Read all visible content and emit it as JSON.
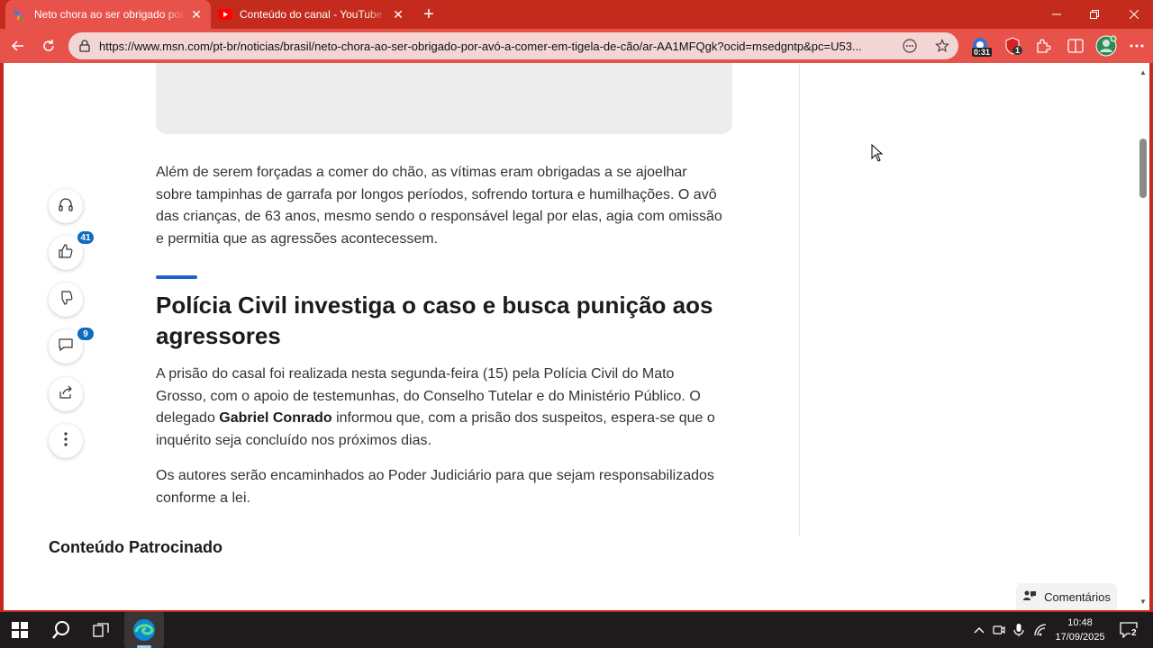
{
  "browser": {
    "tabs": [
      {
        "title": "Neto chora ao ser obrigado por avó",
        "active": true,
        "favicon": "msn-butterfly-icon"
      },
      {
        "title": "Conteúdo do canal - YouTube Studio",
        "active": false,
        "favicon": "youtube-icon"
      }
    ],
    "new_tab": "+",
    "url": "https://www.msn.com/pt-br/noticias/brasil/neto-chora-ao-ser-obrigado-por-avó-a-comer-em-tigela-de-cão/ar-AA1MFQgk?ocid=msedgntp&pc=U53...",
    "extensions": {
      "timer_badge": "0:31",
      "adblock_badge": "1"
    },
    "colors": {
      "frame": "#c42b1c",
      "toolbar": "#e7534a",
      "address": "#f3d6d3"
    }
  },
  "article": {
    "paragraph1": "Além de serem forçadas a comer do chão, as vítimas eram obrigadas a se ajoelhar sobre tampinhas de garrafa por longos períodos, sofrendo tortura e humilhações. O avô das crianças, de 63 anos, mesmo sendo o responsável legal por elas, agia com omissão e permitia que as agressões acontecessem.",
    "heading": "Polícia Civil investiga o caso e busca punição aos agressores",
    "paragraph2_before": "A prisão do casal foi realizada nesta segunda-feira (15) pela Polícia Civil do Mato Grosso, com o apoio de testemunhas, do Conselho Tutelar e do Ministério Público. O delegado ",
    "paragraph2_strong": "Gabriel Conrado",
    "paragraph2_after": " informou que, com a prisão dos suspeitos, espera-se que o inquérito seja concluído nos próximos dias.",
    "paragraph3": "Os autores serão encaminhados ao Poder Judiciário para que sejam responsabilizados conforme a lei.",
    "accent_color": "#1f5fc8"
  },
  "sponsored": {
    "title": "Conteúdo Patrocinado"
  },
  "rail": {
    "like_count": "41",
    "comment_count": "9"
  },
  "comments_pill": {
    "label": "Comentários"
  },
  "taskbar": {
    "time": "10:48",
    "date": "17/09/2025",
    "notification_count": "2"
  }
}
